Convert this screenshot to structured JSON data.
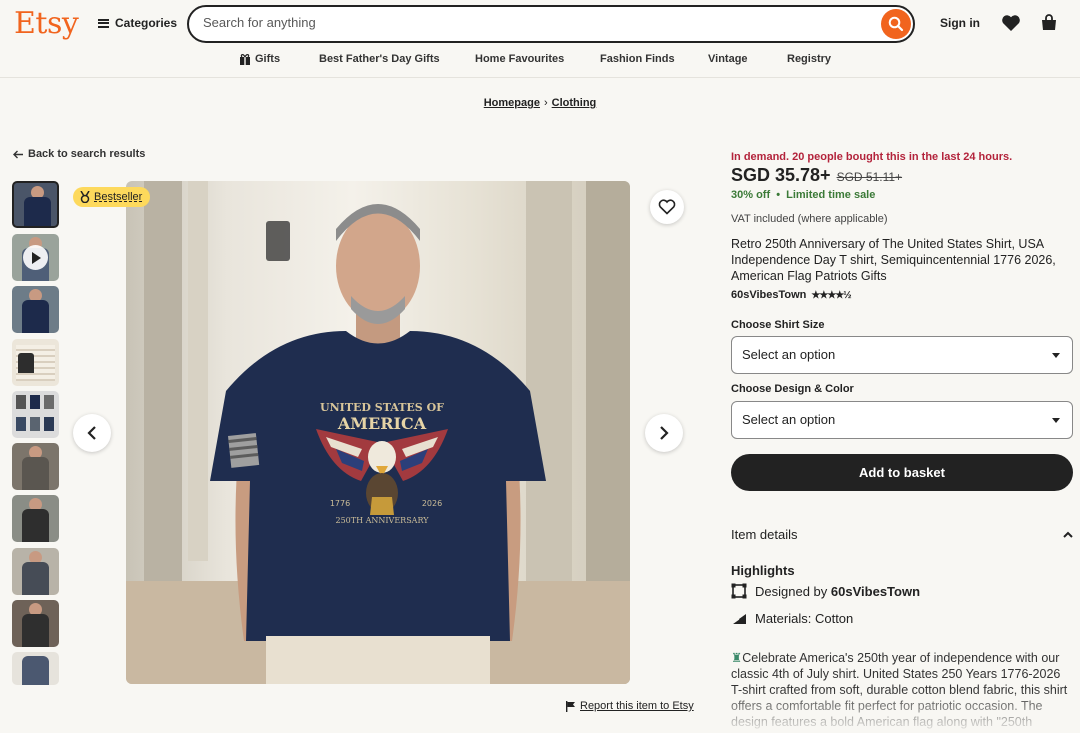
{
  "header": {
    "logo": "Etsy",
    "categories_label": "Categories",
    "search_placeholder": "Search for anything",
    "signin_label": "Sign in"
  },
  "nav": [
    {
      "label": "Gifts",
      "icon": "gift-icon"
    },
    {
      "label": "Best Father's Day Gifts"
    },
    {
      "label": "Home Favourites"
    },
    {
      "label": "Fashion Finds"
    },
    {
      "label": "Vintage"
    },
    {
      "label": "Registry"
    }
  ],
  "breadcrumb": [
    {
      "label": "Homepage"
    },
    {
      "label": "Clothing"
    }
  ],
  "back_label": "Back to search results",
  "bestseller_label": "Bestseller",
  "shirt_print": {
    "line1": "UNITED STATES OF",
    "line2": "AMERICA",
    "year_left": "1776",
    "year_right": "2026",
    "anniversary": "250TH ANNIVERSARY"
  },
  "report_label": "Report this item to Etsy",
  "product": {
    "demand": "In demand. 20 people bought this in the last 24 hours.",
    "price": "SGD 35.78+",
    "old_price": "SGD 51.11+",
    "discount": "30% off",
    "sale_note": "Limited time sale",
    "vat": "VAT included (where applicable)",
    "title": "Retro 250th Anniversary of The United States Shirt, USA Independence Day T shirt, Semiquincentennial 1776 2026, American Flag Patriots Gifts",
    "shop": "60sVibesTown",
    "rating_stars": "★★★★½",
    "size_label": "Choose Shirt Size",
    "size_value": "Select an option",
    "design_label": "Choose Design & Color",
    "design_value": "Select an option",
    "add_to_basket": "Add to basket",
    "item_details": "Item details",
    "highlights": "Highlights",
    "designed_by_prefix": "Designed by",
    "designed_by": "60sVibesTown",
    "materials": "Materials: Cotton",
    "description": "Celebrate America's 250th year of independence with our classic 4th of July shirt. United States 250 Years 1776-2026 T-shirt crafted from soft, durable cotton blend fabric, this shirt offers a comfortable fit perfect for patriotic occasion. The design features a bold American flag along with \"250th"
  },
  "colors": {
    "brand": "#f1641e",
    "demand": "#b3233b",
    "sale": "#3b7a37",
    "bestseller": "#fdd95c",
    "button": "#222222"
  }
}
